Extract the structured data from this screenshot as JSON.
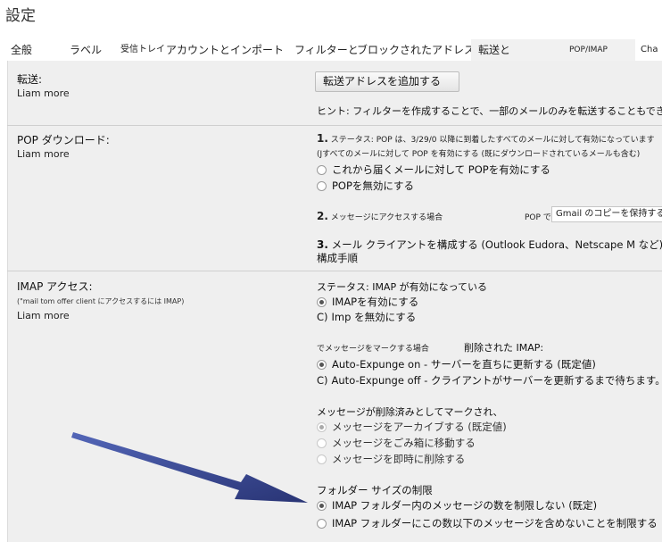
{
  "window": {
    "title": "設定"
  },
  "tabs": [
    {
      "label": "全般"
    },
    {
      "label": "ラベル"
    },
    {
      "label": "受信トレイ"
    },
    {
      "label": "アカウントとインポート"
    },
    {
      "label": "フィルターと"
    },
    {
      "label": "ブロックされたアドレス"
    },
    {
      "label": "転送と"
    },
    {
      "label": "POP/IMAP"
    },
    {
      "label": "Cha"
    }
  ],
  "forwarding": {
    "label": "転送:",
    "learn_more": "Liam more",
    "add_button": "転送アドレスを追加する",
    "hint": "ヒント: フィルターを作成することで、一部のメールのみを転送することもできます。"
  },
  "pop": {
    "label": "POP ダウンロード:",
    "learn_more": "Liam more",
    "step1_num": "1.",
    "step1_status": "ステータス: POP は、3/29/0 以降に到着したすべてのメールに対して有効になっています",
    "step1_note": "(Jすべてのメールに対して POP を有効にする (既にダウンロードされているメールも含む)",
    "opt_enable_new": "これから届くメールに対して POPを有効にする",
    "opt_disable": "POPを無効にする",
    "step2_num": "2.",
    "step2_text": "メッセージにアクセスする場合",
    "step2_pop": "POP で",
    "step2_select": "Gmail のコピーを保持する",
    "step3_num": "3.",
    "step3_text": "メール クライアントを構成する (Outlook Eudora、Netscape M など)。",
    "step3_link": "構成手順"
  },
  "imap": {
    "label": "IMAP アクセス:",
    "note": "(\"mail tom offer client にアクセスするには IMAP)",
    "learn_more": "Liam more",
    "status": "ステータス: IMAP が有効になっている",
    "opt_enable": "IMAPを有効にする",
    "opt_disable_prefix": "C)",
    "opt_disable": "Imp を無効にする",
    "mark_heading": "でメッセージをマークする場合",
    "mark_heading2": "削除された IMAP:",
    "expunge_on": "Auto-Expunge on - サーバーを直ちに更新する (既定値)",
    "expunge_off_prefix": "C)",
    "expunge_off": "Auto-Expunge off - クライアントがサーバーを更新するまで待ちます。",
    "deleted_heading": "メッセージが削除済みとしてマークされ、",
    "del_archive": "メッセージをアーカイブする (既定値)",
    "del_trash": "メッセージをごみ箱に移動する",
    "del_now": "メッセージを即時に削除する",
    "folder_heading": "フォルダー サイズの制限",
    "folder_unlimited": "IMAP フォルダー内のメッセージの数を制限しない (既定)",
    "folder_limit": "IMAP フォルダーにこの数以下のメッセージを含めないことを制限する"
  },
  "colors": {
    "arrow": "#2b3a8c",
    "panel_bg": "#efefef",
    "active_tab_bg": "#f1f1f1"
  }
}
